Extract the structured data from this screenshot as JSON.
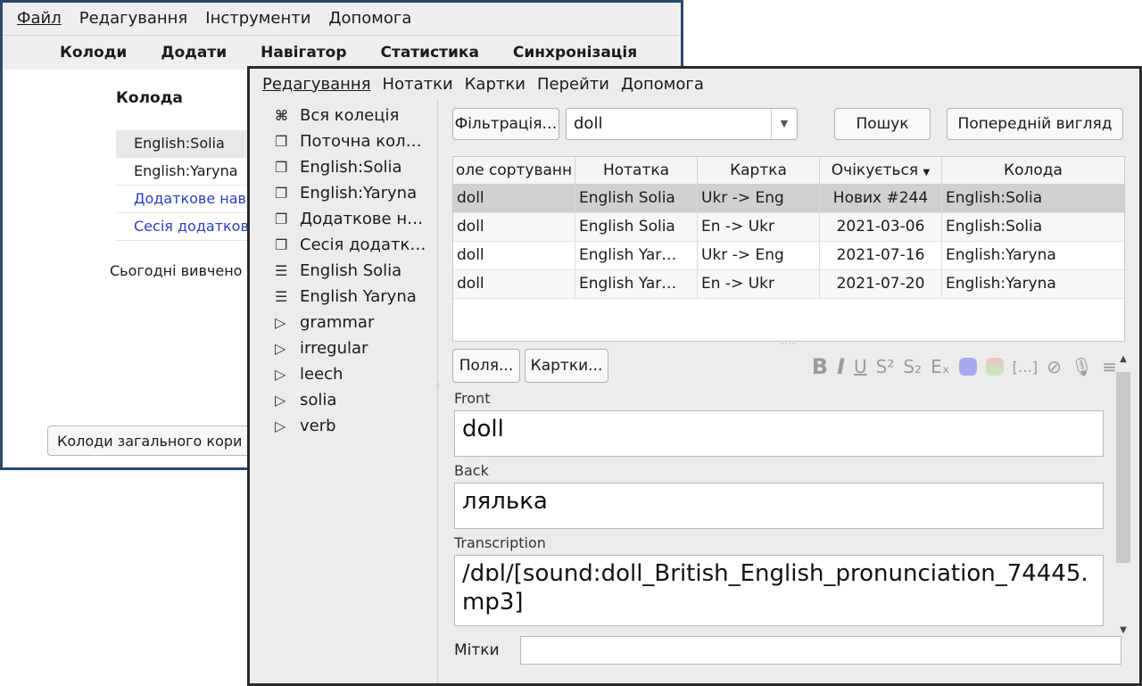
{
  "main_window": {
    "menu": [
      {
        "label": "Файл"
      },
      {
        "label": "Редагування"
      },
      {
        "label": "Інструменти"
      },
      {
        "label": "Допомога"
      }
    ],
    "toolbar": [
      "Колоди",
      "Додати",
      "Навігатор",
      "Статистика",
      "Синхронізація"
    ],
    "deck_header": "Колода",
    "decks": [
      {
        "name": "English:Solia",
        "style": "selected"
      },
      {
        "name": "English:Yaryna",
        "style": "normal"
      },
      {
        "name": "Додаткове нав",
        "style": "link"
      },
      {
        "name": "Сесія додатков",
        "style": "link"
      }
    ],
    "today_text": "Сьогодні вивчено",
    "shared_decks_button": "Колоди загального кори"
  },
  "browser": {
    "menu": [
      "Редагування",
      "Нотатки",
      "Картки",
      "Перейти",
      "Допомога"
    ],
    "sidebar": [
      {
        "icon": "collection-icon",
        "glyph": "⌘",
        "label": "Вся колеція"
      },
      {
        "icon": "deck-icon",
        "glyph": "🗍",
        "label": "Поточна кол…"
      },
      {
        "icon": "deck-icon",
        "glyph": "🗍",
        "label": "English:Solia"
      },
      {
        "icon": "deck-icon",
        "glyph": "🗍",
        "label": "English:Yaryna"
      },
      {
        "icon": "deck-icon",
        "glyph": "🗍",
        "label": "Додаткове н…"
      },
      {
        "icon": "deck-icon",
        "glyph": "🗍",
        "label": "Сесія додатк…"
      },
      {
        "icon": "notetype-icon",
        "glyph": "☰",
        "label": "English Solia"
      },
      {
        "icon": "notetype-icon",
        "glyph": "☰",
        "label": "English Yaryna"
      },
      {
        "icon": "tag-icon",
        "glyph": "⏵",
        "label": "grammar"
      },
      {
        "icon": "tag-icon",
        "glyph": "⏵",
        "label": "irregular"
      },
      {
        "icon": "tag-icon",
        "glyph": "⏵",
        "label": "leech"
      },
      {
        "icon": "tag-icon",
        "glyph": "⏵",
        "label": "solia"
      },
      {
        "icon": "tag-icon",
        "glyph": "⏵",
        "label": "verb"
      }
    ],
    "filter_button": "Фільтрація…",
    "search_value": "doll",
    "search_button": "Пошук",
    "preview_button": "Попередній вигляд",
    "columns": [
      "оле сортуванн",
      "Нотатка",
      "Картка",
      "Очікується",
      "Колода"
    ],
    "rows": [
      [
        "doll",
        "English Solia",
        "Ukr -> Eng",
        "Нових #244",
        "English:Solia"
      ],
      [
        "doll",
        "English Solia",
        "En -> Ukr",
        "2021-03-06",
        "English:Solia"
      ],
      [
        "doll",
        "English Yar…",
        "Ukr -> Eng",
        "2021-07-16",
        "English:Yaryna"
      ],
      [
        "doll",
        "English Yar…",
        "En -> Ukr",
        "2021-07-20",
        "English:Yaryna"
      ]
    ],
    "fields_button": "Поля...",
    "cards_button": "Картки...",
    "fields": [
      {
        "label": "Front",
        "value": "doll"
      },
      {
        "label": "Back",
        "value": "лялька"
      },
      {
        "label": "Transcription",
        "value": "/dɒl/[sound:doll_British_English_pronunciation_74445.mp3]"
      }
    ],
    "tags_label": "Мітки",
    "tags_value": "",
    "colors": {
      "highlight_swatch": "#a8a8f0",
      "text_color_swatch": "#f0c0c0"
    }
  }
}
